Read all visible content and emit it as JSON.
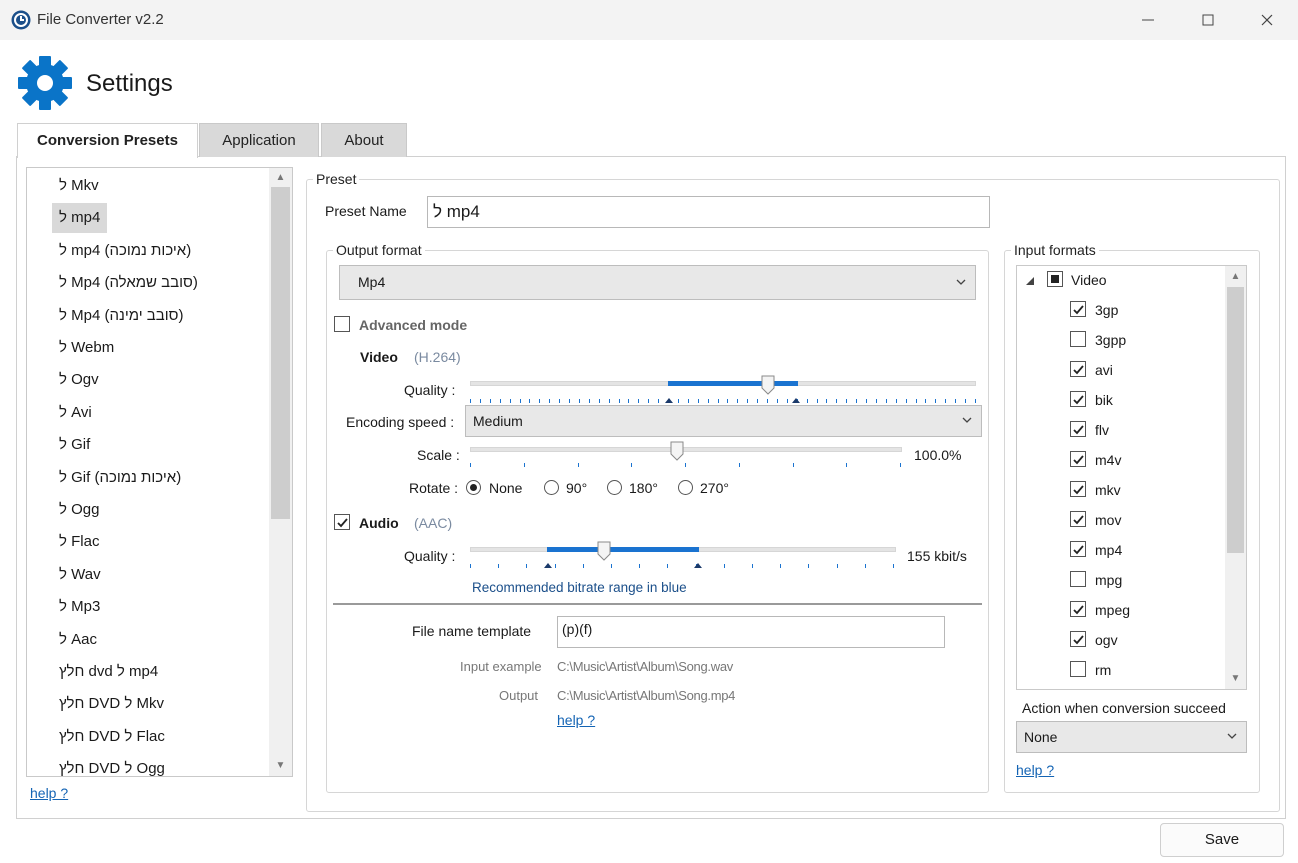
{
  "window": {
    "title": "File Converter v2.2"
  },
  "header": {
    "title": "Settings"
  },
  "tabs": [
    {
      "label": "Conversion Presets"
    },
    {
      "label": "Application"
    },
    {
      "label": "About"
    }
  ],
  "presets": {
    "selected_index": 1,
    "items": [
      "ל Mkv",
      "ל mp4",
      "ל mp4 (איכות נמוכה)",
      "ל Mp4 (סובב שמאלה)",
      "ל Mp4 (סובב ימינה)",
      "ל Webm",
      "ל Ogv",
      "ל Avi",
      "ל Gif",
      "ל Gif (איכות נמוכה)",
      "ל Ogg",
      "ל Flac",
      "ל Wav",
      "ל Mp3",
      "ל Aac",
      "חלץ dvd ל mp4",
      "חלץ DVD ל Mkv",
      "חלץ DVD ל Flac",
      "חלץ DVD ל Ogg"
    ],
    "help": "help ?"
  },
  "preset": {
    "group_label": "Preset",
    "name_label": "Preset Name",
    "name_value": "ל mp4",
    "output_format": {
      "group_label": "Output format",
      "selected": "Mp4",
      "advanced_mode_label": "Advanced mode",
      "advanced_mode_checked": false,
      "video": {
        "label": "Video",
        "codec": "(H.264)",
        "quality_label": "Quality :",
        "quality_value": 0.59,
        "encoding_speed_label": "Encoding speed :",
        "encoding_speed": "Medium",
        "scale_label": "Scale :",
        "scale_value": "100.0%",
        "rotate_label": "Rotate :",
        "rotate_options": [
          "None",
          "90°",
          "180°",
          "270°"
        ],
        "rotate_selected": 0
      },
      "audio": {
        "label": "Audio",
        "checked": true,
        "codec": "(AAC)",
        "quality_label": "Quality :",
        "quality_value": "155 kbit/s",
        "recommended_note": "Recommended bitrate range in blue"
      },
      "file_name_template_label": "File name template",
      "file_name_template_value": "(p)(f)",
      "input_example_label": "Input example",
      "input_example_value": "C:\\Music\\Artist\\Album\\Song.wav",
      "output_label": "Output",
      "output_value": "C:\\Music\\Artist\\Album\\Song.mp4",
      "help": "help ?"
    },
    "input_formats": {
      "group_label": "Input formats",
      "category": "Video",
      "items": [
        {
          "name": "3gp",
          "checked": true
        },
        {
          "name": "3gpp",
          "checked": false
        },
        {
          "name": "avi",
          "checked": true
        },
        {
          "name": "bik",
          "checked": true
        },
        {
          "name": "flv",
          "checked": true
        },
        {
          "name": "m4v",
          "checked": true
        },
        {
          "name": "mkv",
          "checked": true
        },
        {
          "name": "mov",
          "checked": true
        },
        {
          "name": "mp4",
          "checked": true
        },
        {
          "name": "mpg",
          "checked": false
        },
        {
          "name": "mpeg",
          "checked": true
        },
        {
          "name": "ogv",
          "checked": true
        },
        {
          "name": "rm",
          "checked": false
        }
      ],
      "action_label": "Action when conversion succeed",
      "action_value": "None",
      "help": "help ?"
    }
  },
  "footer": {
    "save_label": "Save"
  },
  "colors": {
    "accent": "#1a73d0",
    "link": "#1464b4",
    "gear": "#0a74c8"
  }
}
